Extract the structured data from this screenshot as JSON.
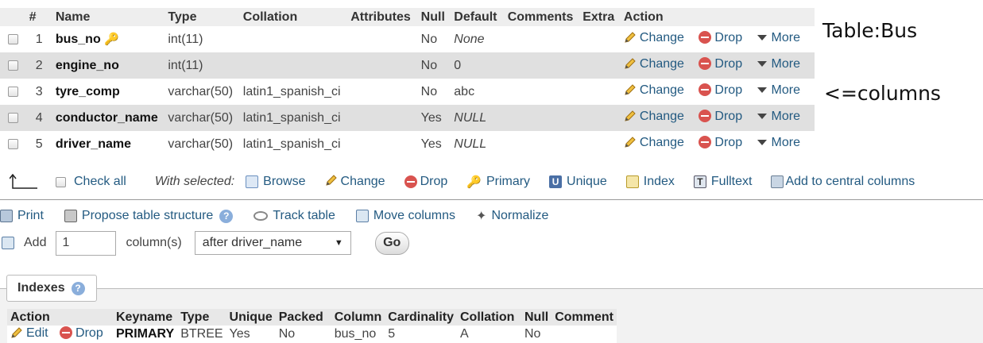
{
  "structure_table": {
    "headers": [
      "#",
      "Name",
      "Type",
      "Collation",
      "Attributes",
      "Null",
      "Default",
      "Comments",
      "Extra",
      "Action"
    ],
    "rows": [
      {
        "num": "1",
        "name": "bus_no",
        "type": "int(11)",
        "collation": "",
        "attributes": "",
        "null": "No",
        "default": "None",
        "comments": "",
        "extra": "",
        "is_primary": true
      },
      {
        "num": "2",
        "name": "engine_no",
        "type": "int(11)",
        "collation": "",
        "attributes": "",
        "null": "No",
        "default": "0",
        "comments": "",
        "extra": "",
        "is_primary": false
      },
      {
        "num": "3",
        "name": "tyre_comp",
        "type": "varchar(50)",
        "collation": "latin1_spanish_ci",
        "attributes": "",
        "null": "No",
        "default": "abc",
        "comments": "",
        "extra": "",
        "is_primary": false
      },
      {
        "num": "4",
        "name": "conductor_name",
        "type": "varchar(50)",
        "collation": "latin1_spanish_ci",
        "attributes": "",
        "null": "Yes",
        "default": "NULL",
        "comments": "",
        "extra": "",
        "is_primary": false
      },
      {
        "num": "5",
        "name": "driver_name",
        "type": "varchar(50)",
        "collation": "latin1_spanish_ci",
        "attributes": "",
        "null": "Yes",
        "default": "NULL",
        "comments": "",
        "extra": "",
        "is_primary": false
      }
    ],
    "row_actions": {
      "change": "Change",
      "drop": "Drop",
      "more": "More"
    }
  },
  "annotations": {
    "table_label": "Table:Bus",
    "columns_label": "<=columns"
  },
  "bulk_actions": {
    "check_all": "Check all",
    "with_selected": "With selected:",
    "browse": "Browse",
    "change": "Change",
    "drop": "Drop",
    "primary": "Primary",
    "unique": "Unique",
    "index": "Index",
    "fulltext": "Fulltext",
    "add_central": "Add to central columns"
  },
  "toolbar": {
    "print": "Print",
    "propose": "Propose table structure",
    "track": "Track table",
    "move": "Move columns",
    "normalize": "Normalize"
  },
  "add_column": {
    "label": "Add",
    "count": "1",
    "unit": "column(s)",
    "position": "after driver_name",
    "go": "Go"
  },
  "indexes": {
    "title": "Indexes",
    "headers": [
      "Action",
      "Keyname",
      "Type",
      "Unique",
      "Packed",
      "Column",
      "Cardinality",
      "Collation",
      "Null",
      "Comment"
    ],
    "rows": [
      {
        "edit": "Edit",
        "drop": "Drop",
        "keyname": "PRIMARY",
        "type": "BTREE",
        "unique": "Yes",
        "packed": "No",
        "column": "bus_no",
        "cardinality": "5",
        "collation": "A",
        "null": "No",
        "comment": ""
      }
    ]
  },
  "colors": {
    "link": "#235a81",
    "drop_red": "#d9534f",
    "row_alt": "#e0e0e0",
    "header_bg": "#eeeeee"
  }
}
